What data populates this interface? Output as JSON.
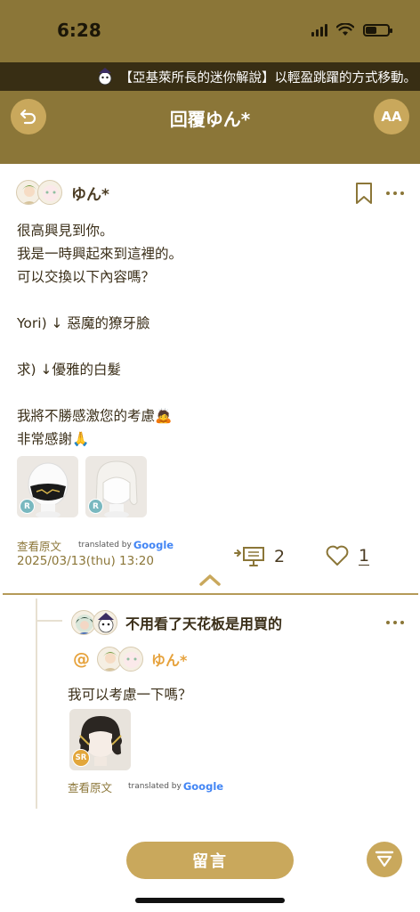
{
  "status_bar": {
    "time": "6:28"
  },
  "ticker": {
    "text": "【亞基萊所長的迷你解說】以輕盈跳躍的方式移動。"
  },
  "header": {
    "title": "回覆ゆん*",
    "font_button_label": "AA"
  },
  "post": {
    "username": "ゆん*",
    "body": "很高興見到你。\n我是一時興起來到這裡的。\n可以交換以下內容嗎？\n\n Yori) ↓ 惡魔的獠牙臉\n\n求) ↓優雅的白髮\n\n我將不勝感激您的考慮🙇\n非常感謝🙏",
    "items": [
      {
        "name": "black mask",
        "rarity": "R"
      },
      {
        "name": "white hair",
        "rarity": "R"
      }
    ],
    "view_original": "查看原文",
    "translated_by": "translated by",
    "google": "Google",
    "date": "2025/03/13(thu) 13:20",
    "reply_count": "2",
    "like_count": "1"
  },
  "reply": {
    "username": "不用看了天花板是用買的",
    "mention_name": "ゆん*",
    "at": "@",
    "body": "我可以考慮一下嗎？",
    "item": {
      "name": "dark hair",
      "rarity": "SR"
    },
    "view_original": "查看原文",
    "translated_by": "translated by",
    "google": "Google"
  },
  "bottom": {
    "comment_label": "留言"
  },
  "colors": {
    "header": "#8b7638",
    "accent": "#c9a85c",
    "mention": "#e6a23c"
  }
}
